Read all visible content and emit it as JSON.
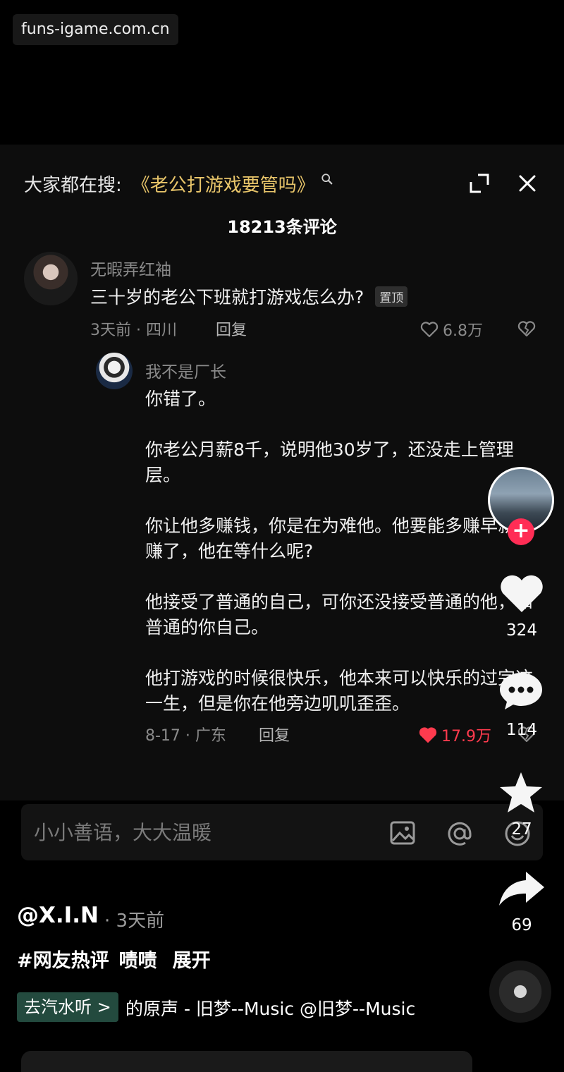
{
  "watermark": "funs-igame.com.cn",
  "search": {
    "prefix": "大家都在搜:",
    "term": "《老公打游戏要管吗》"
  },
  "comment_count": "18213条评论",
  "comment1": {
    "username": "无暇弄红袖",
    "text": "三十岁的老公下班就打游戏怎么办?",
    "pin_badge": "置顶",
    "meta": "3天前 · 四川",
    "reply_label": "回复",
    "likes": "6.8万"
  },
  "comment2": {
    "username": "我不是厂长",
    "paragraphs": [
      "你错了。",
      "你老公月薪8千，说明他30岁了，还没走上管理层。",
      "你让他多赚钱，你是在为难他。他要能多赚早就多赚了，他在等什么呢?",
      "他接受了普通的自己，可你还没接受普通的他，和普通的你自己。",
      "他打游戏的时候很快乐，他本来可以快乐的过完这一生，但是你在他旁边叽叽歪歪。"
    ],
    "meta": "8-17 · 广东",
    "reply_label": "回复",
    "likes": "17.9万"
  },
  "input": {
    "placeholder": "小小善语，大大温暖"
  },
  "sidebar": {
    "follow_label": "+",
    "likes": "324",
    "comments": "114",
    "favorites": "27",
    "shares": "69"
  },
  "video": {
    "author": "@X.I.N",
    "time": "· 3天前",
    "tags": [
      "#网友热评",
      "啧啧"
    ],
    "expand_label": "展开",
    "music_chip": "去汽水听 >",
    "music_text": "的原声 - 旧梦--Music    @旧梦--Music"
  },
  "colors": {
    "accent_gold": "#e8c56a",
    "like_red": "#ff3b4e",
    "follow_pink": "#ff2d55",
    "chip_green": "#234a3e"
  },
  "icons": [
    "search-icon",
    "expand-icon",
    "close-icon",
    "heart-icon",
    "broken-heart-icon",
    "image-icon",
    "at-icon",
    "emoji-icon",
    "comment-bubble-icon",
    "star-icon",
    "share-arrow-icon"
  ]
}
